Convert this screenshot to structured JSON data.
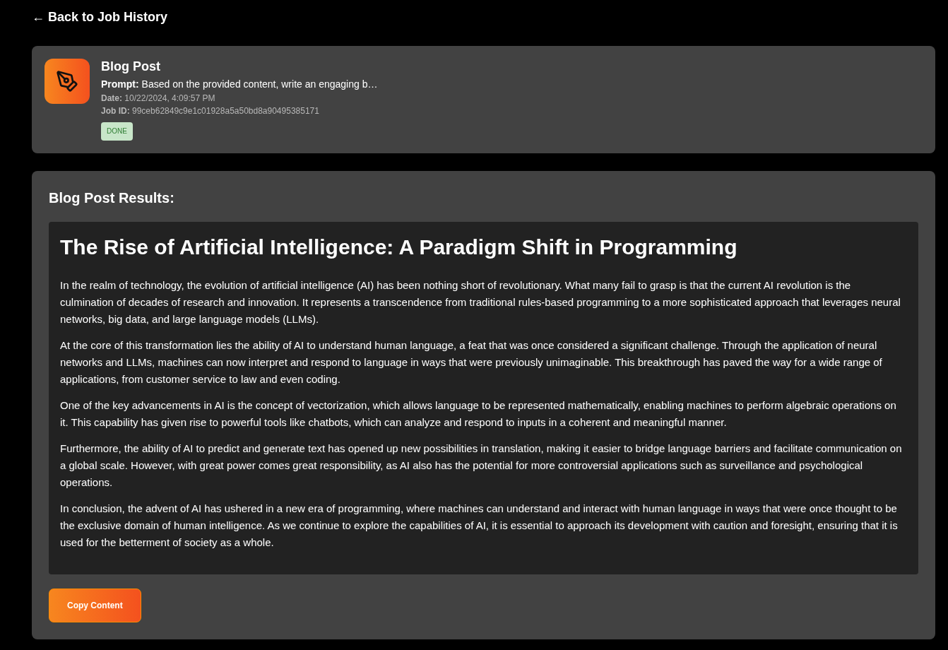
{
  "back_link": "← Back to Job History",
  "job": {
    "title": "Blog Post",
    "prompt": "**Prompt:** Based on the provided content, write an engaging b…",
    "date": "**Date:** 10/22/2024, 4:09:57 PM",
    "job_id": "**Job ID:** 99ceb62849c9e1c01928a5a50bd8a90495385171",
    "status": {
      "label": "DONE",
      "kind": "done"
    }
  },
  "results": {
    "heading": "Blog Post Results:",
    "article": {
      "title": "The Rise of Artificial Intelligence: A Paradigm Shift in Programming",
      "paragraphs": [
        "In the realm of technology, the evolution of artificial intelligence (AI) has been nothing short of revolutionary. What many fail to grasp is that the current AI revolution is the culmination of decades of research and innovation. It represents a transcendence from traditional rules-based programming to a more sophisticated approach that leverages neural networks, big data, and large language models (LLMs).",
        "At the core of this transformation lies the ability of AI to understand human language, a feat that was once considered a significant challenge. Through the application of neural networks and LLMs, machines can now interpret and respond to language in ways that were previously unimaginable. This breakthrough has paved the way for a wide range of applications, from customer service to law and even coding.",
        "One of the key advancements in AI is the concept of vectorization, which allows language to be represented mathematically, enabling machines to perform algebraic operations on it. This capability has given rise to powerful tools like chatbots, which can analyze and respond to inputs in a coherent and meaningful manner.",
        "Furthermore, the ability of AI to predict and generate text has opened up new possibilities in translation, making it easier to bridge language barriers and facilitate communication on a global scale. However, with great power comes great responsibility, as AI also has the potential for more controversial applications such as surveillance and psychological operations.",
        "In conclusion, the advent of AI has ushered in a new era of programming, where machines can understand and interact with human language in ways that were once thought to be the exclusive domain of human intelligence. As we continue to explore the capabilities of AI, it is essential to approach its development with caution and foresight, ensuring that it is used for the betterment of society as a whole."
      ]
    },
    "copy_button": "Copy Content"
  }
}
